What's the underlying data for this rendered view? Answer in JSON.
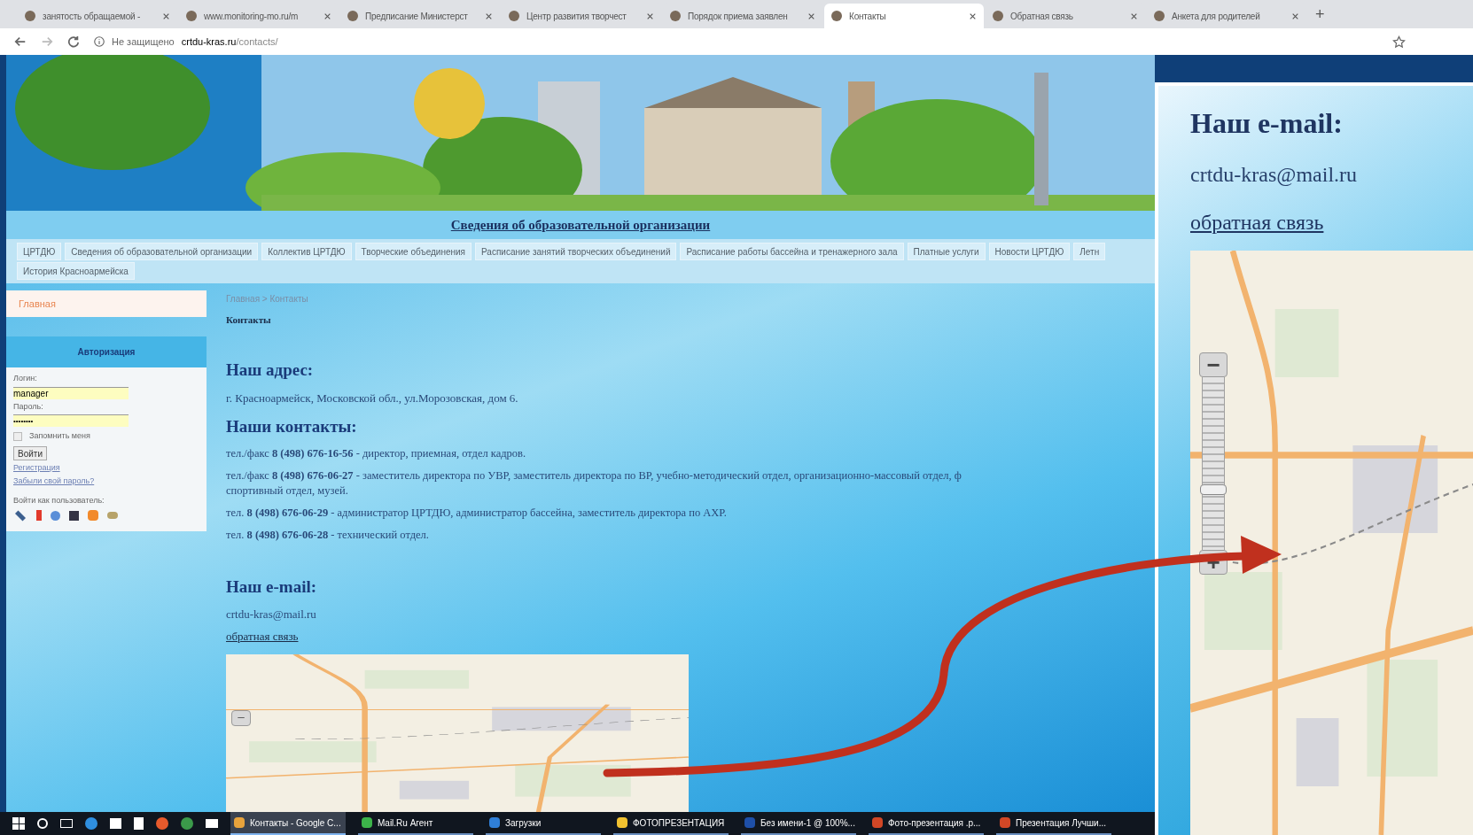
{
  "browser": {
    "tabs": [
      {
        "title": "занятость обращаемой -",
        "selected": false
      },
      {
        "title": "www.monitoring-mo.ru/m",
        "selected": false
      },
      {
        "title": "Предписание Министерст",
        "selected": false
      },
      {
        "title": "Центр развития творчест",
        "selected": false
      },
      {
        "title": "Порядок приема заявлен",
        "selected": false
      },
      {
        "title": "Контакты",
        "selected": true
      },
      {
        "title": "Обратная связь",
        "selected": false
      },
      {
        "title": "Анкета для родителей",
        "selected": false
      }
    ],
    "new_tab": "+",
    "address": {
      "security": "Не защищено",
      "domain": "crtdu-kras.ru",
      "path": "/contacts/"
    }
  },
  "site": {
    "banner_link": "Сведения об образовательной организации",
    "nav": [
      {
        "label": "ЦРТДЮ",
        "selected": false
      },
      {
        "label": "Сведения об образовательной организации",
        "selected": false
      },
      {
        "label": "Коллектив ЦРТДЮ",
        "selected": false
      },
      {
        "label": "Творческие объединения",
        "selected": false
      },
      {
        "label": "Расписание занятий творческих объединений",
        "selected": false
      },
      {
        "label": "Расписание работы бассейна и тренажерного зала",
        "selected": false
      },
      {
        "label": "Платные услуги",
        "selected": false
      },
      {
        "label": "Новости ЦРТДЮ",
        "selected": false
      },
      {
        "label": "Летн",
        "selected": false
      },
      {
        "label": "История Красноармейска",
        "selected": false
      }
    ],
    "sidebar": {
      "home": "Главная",
      "auth_title": "Авторизация",
      "login_label": "Логин:",
      "login_value": "manager",
      "password_label": "Пароль:",
      "password_value": "••••••••",
      "remember_label": "Запомнить меня",
      "remember": false,
      "submit": "Войти",
      "register": "Регистрация",
      "forgot": "Забыли свой пароль?",
      "social_label": "Войти как пользователь:"
    },
    "breadcrumb": "Главная > Контакты",
    "page_title": "Контакты",
    "address_heading": "Наш адрес:",
    "address": "г. Красноармейск, Московской обл., ул.Морозовская, дом 6.",
    "contacts_heading": "Наши контакты:",
    "contacts": [
      [
        "тел./факс **8 (498) 676-16-56** - директор, приемная, отдел кадров."
      ],
      [
        "тел./факс **8 (498) 676-06-27** - заместитель директора по УВР, заместитель директора по ВР, учебно-методический отдел, организационно-массовый отдел, ф",
        "спортивный отдел, музей."
      ],
      [
        "тел. **8 (498) 676-06-29** - администратор ЦРТДЮ, администратор бассейна, заместитель директора по АХР."
      ],
      [
        "тел. **8 (498) 676-06-28** - технический отдел."
      ]
    ],
    "email_heading": "Наш e-mail:",
    "email": "crtdu-kras@mail.ru",
    "feedback": "обратная связь",
    "map_zoom_out": "−"
  },
  "taskbar": [
    {
      "label": "Контакты - Google C...",
      "color": "#e8a33c",
      "selected": true
    },
    {
      "label": "Mail.Ru Агент",
      "color": "#3cb34a",
      "selected": false
    },
    {
      "label": "Загрузки",
      "color": "#2f7fd8",
      "selected": false
    },
    {
      "label": "ФОТОПРЕЗЕНТАЦИЯ",
      "color": "#f2c230",
      "selected": false
    },
    {
      "label": "Без имени-1 @ 100%...",
      "color": "#1e4fa8",
      "selected": false
    },
    {
      "label": "Фото-презентация .р...",
      "color": "#d24726",
      "selected": false
    },
    {
      "label": "Презентация Лучши...",
      "color": "#d24726",
      "selected": false
    }
  ],
  "inset": {
    "email_heading": "Наш e-mail:",
    "email": "crtdu-kras@mail.ru",
    "feedback": "обратная связь",
    "zoom_out": "−",
    "zoom_in": "+",
    "zoom_slider": {
      "level": 0.35
    }
  }
}
